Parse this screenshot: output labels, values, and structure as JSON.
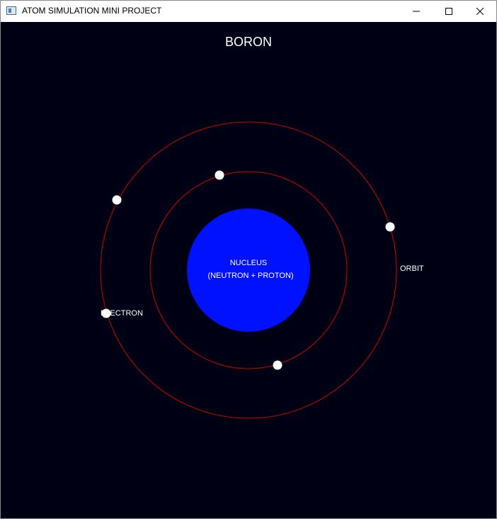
{
  "window": {
    "title": "ATOM SIMULATION MINI PROJECT",
    "controls": [
      "minimize",
      "maximize",
      "close"
    ]
  },
  "scene": {
    "element_name": "BORON",
    "labels": {
      "nucleus": "NUCLEUS",
      "nucleus_detail": "(NEUTRON + PROTON)",
      "orbit": "ORBIT",
      "electron": "ELECTRON"
    },
    "colors": {
      "background": "#000015",
      "nucleus": "#0011ff",
      "orbit": "#cc0000",
      "electron": "#ffffff"
    },
    "shells": [
      {
        "name": "inner",
        "electron_count": 2
      },
      {
        "name": "outer",
        "electron_count": 3
      }
    ]
  }
}
